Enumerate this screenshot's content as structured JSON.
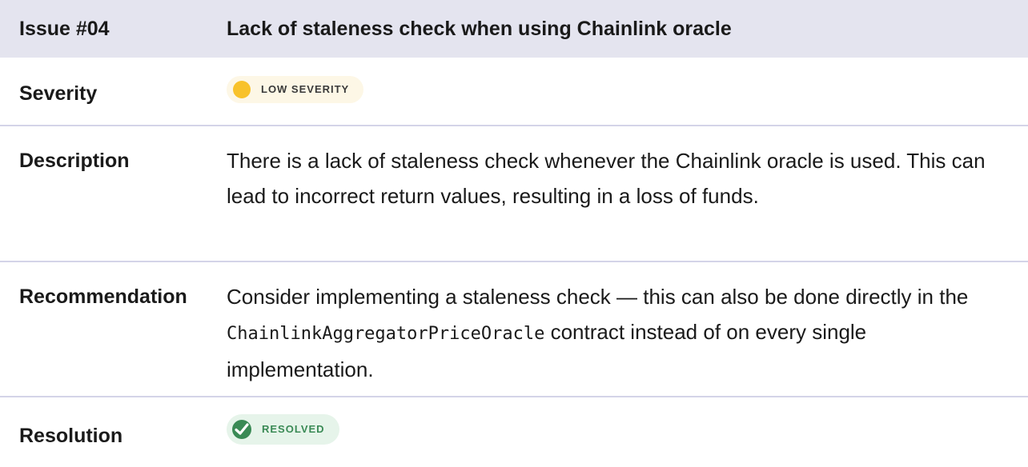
{
  "header": {
    "issue_label": "Issue #04",
    "issue_title": "Lack of staleness check when using Chainlink oracle"
  },
  "severity": {
    "label": "Severity",
    "badge_text": "LOW SEVERITY",
    "badge_icon": "yellow-dot-icon",
    "badge_color": "#f8c22b"
  },
  "description": {
    "label": "Description",
    "text": "There is a lack of staleness check whenever the Chainlink oracle is used. This can lead to incorrect return values, resulting in a loss of funds."
  },
  "recommendation": {
    "label": "Recommendation",
    "text_before": "Consider implementing a staleness check — this can also be done directly in the ",
    "code": "ChainlinkAggregatorPriceOracle",
    "text_after": " contract instead of on every single implementation."
  },
  "resolution": {
    "label": "Resolution",
    "badge_text": "RESOLVED",
    "badge_icon": "check-circle-icon",
    "badge_color": "#3a8a55"
  }
}
